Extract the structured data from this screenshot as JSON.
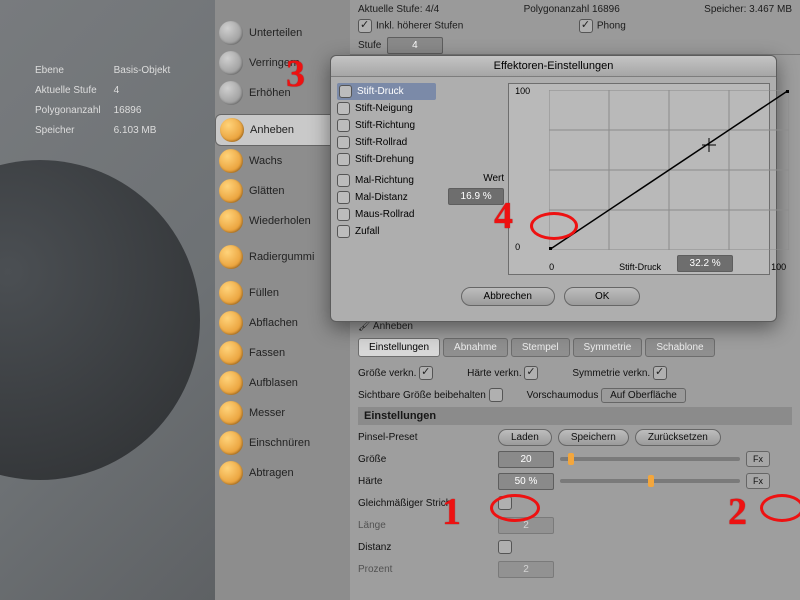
{
  "hud": {
    "ebene_l": "Ebene",
    "ebene_v": "Basis-Objekt",
    "stufe_l": "Aktuelle Stufe",
    "stufe_v": "4",
    "poly_l": "Polygonanzahl",
    "poly_v": "16896",
    "spe_l": "Speicher",
    "spe_v": "6.103 MB"
  },
  "tools": [
    "Unterteilen",
    "Verringern",
    "Erhöhen",
    "Anheben",
    "Wachs",
    "Glätten",
    "Wiederholen",
    "Radiergummi",
    "Füllen",
    "Abflachen",
    "Fassen",
    "Aufblasen",
    "Messer",
    "Einschnüren",
    "Abtragen"
  ],
  "topstrip": {
    "inkl": "Inkl. höherer Stufen",
    "phong": "Phong",
    "stufe_l": "Stufe",
    "stufe_v": "4",
    "aktstufe": "Aktuelle Stufe: 4/4",
    "poly": "Polygonanzahl   16896",
    "speicher": "Speicher: 3.467 MB"
  },
  "modal": {
    "title": "Effektoren-Einstellungen",
    "opts": [
      "Stift-Druck",
      "Stift-Neigung",
      "Stift-Richtung",
      "Stift-Rollrad",
      "Stift-Drehung",
      "Mal-Richtung",
      "Mal-Distanz",
      "Maus-Rollrad",
      "Zufall"
    ],
    "wert_l": "Wert",
    "wert_v": "16.9 %",
    "xaxis": "Stift-Druck",
    "xval": "32.2 %",
    "y100": "100",
    "y0": "0",
    "x0": "0",
    "x100": "100",
    "cancel": "Abbrechen",
    "ok": "OK"
  },
  "lower": {
    "brushname": "Anheben",
    "tabs": [
      "Einstellungen",
      "Abnahme",
      "Stempel",
      "Symmetrie",
      "Schablone"
    ],
    "gverkn": "Größe verkn.",
    "hverkn": "Härte verkn.",
    "sverkn": "Symmetrie verkn.",
    "sicht": "Sichtbare Größe beibehalten",
    "vorschau_l": "Vorschaumodus",
    "vorschau_v": "Auf Oberfläche",
    "einst": "Einstellungen",
    "preset_l": "Pinsel-Preset",
    "laden": "Laden",
    "speichern": "Speichern",
    "reset": "Zurücksetzen",
    "groesse_l": "Größe",
    "groesse_v": "20",
    "haerte_l": "Härte",
    "haerte_v": "50 %",
    "gleich": "Gleichmäßiger Strich",
    "laenge_l": "Länge",
    "laenge_v": "2",
    "distanz_l": "Distanz",
    "prozent_l": "Prozent",
    "prozent_v": "2",
    "fx": "Fx"
  },
  "ann": {
    "n1": "1",
    "n2": "2",
    "n3": "3",
    "n4": "4"
  },
  "chart_data": {
    "type": "line",
    "title": "Effektoren-Einstellungen",
    "xlabel": "Stift-Druck",
    "ylabel": "Wert",
    "xlim": [
      0,
      100
    ],
    "ylim": [
      0,
      100
    ],
    "x": [
      0,
      100
    ],
    "y": [
      0,
      100
    ],
    "marker": {
      "x": 32.2,
      "y": 16.9
    }
  }
}
